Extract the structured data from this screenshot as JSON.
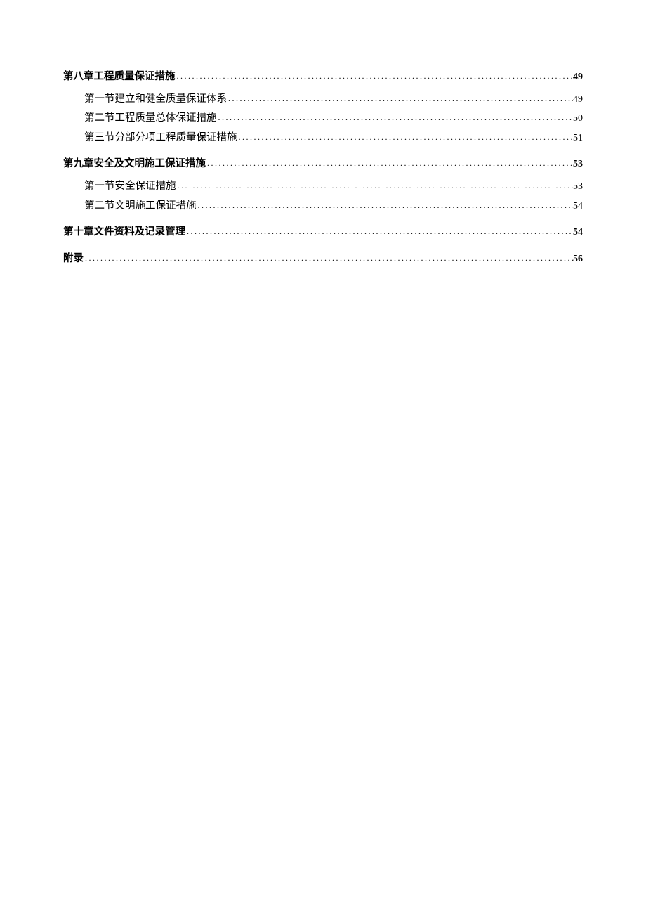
{
  "toc": [
    {
      "level": 1,
      "bold": true,
      "title": "第八章工程质量保证措施",
      "page": "49"
    },
    {
      "level": 2,
      "bold": false,
      "title": "第一节建立和健全质量保证体系",
      "page": "49"
    },
    {
      "level": 2,
      "bold": false,
      "title": "第二节工程质量总体保证措施",
      "page": "50"
    },
    {
      "level": 2,
      "bold": false,
      "title": "第三节分部分项工程质量保证措施",
      "page": "51"
    },
    {
      "level": 1,
      "bold": true,
      "title": "第九章安全及文明施工保证措施",
      "page": "53"
    },
    {
      "level": 2,
      "bold": false,
      "title": "第一节安全保证措施",
      "page": "53"
    },
    {
      "level": 2,
      "bold": false,
      "title": "第二节文明施工保证措施",
      "page": "54"
    },
    {
      "level": 1,
      "bold": true,
      "title": "第十章文件资料及记录管理",
      "page": "54"
    },
    {
      "level": 1,
      "bold": true,
      "title": "附录",
      "page": "56"
    }
  ]
}
